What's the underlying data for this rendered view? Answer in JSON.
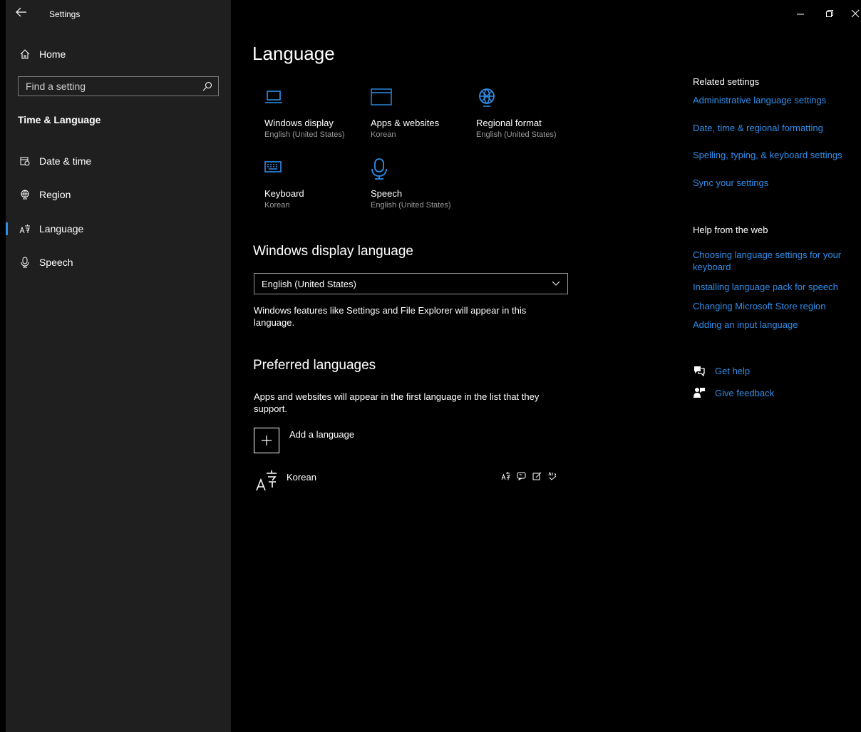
{
  "window": {
    "title": "Settings"
  },
  "sidebar": {
    "home_label": "Home",
    "search_placeholder": "Find a setting",
    "section_title": "Time & Language",
    "items": [
      {
        "label": "Date & time",
        "icon": "calendar-clock-icon"
      },
      {
        "label": "Region",
        "icon": "globe-icon"
      },
      {
        "label": "Language",
        "icon": "language-icon",
        "active": true
      },
      {
        "label": "Speech",
        "icon": "microphone-icon"
      }
    ]
  },
  "main": {
    "title": "Language",
    "tiles": [
      {
        "label": "Windows display",
        "sub": "English (United States)",
        "icon": "monitor-icon"
      },
      {
        "label": "Apps & websites",
        "sub": "Korean",
        "icon": "browser-window-icon"
      },
      {
        "label": "Regional format",
        "sub": "English (United States)",
        "icon": "globe-icon"
      },
      {
        "label": "Keyboard",
        "sub": "Korean",
        "icon": "keyboard-icon"
      },
      {
        "label": "Speech",
        "sub": "English (United States)",
        "icon": "microphone-icon"
      }
    ],
    "display_language": {
      "heading": "Windows display language",
      "selected": "English (United States)",
      "description": "Windows features like Settings and File Explorer will appear in this language."
    },
    "preferred": {
      "heading": "Preferred languages",
      "description": "Apps and websites will appear in the first language in the list that they support.",
      "add_label": "Add a language",
      "languages": [
        {
          "name": "Korean",
          "features": [
            "display-language-icon",
            "speech-icon",
            "handwriting-icon",
            "spell-check-icon"
          ]
        }
      ]
    }
  },
  "related": {
    "heading": "Related settings",
    "links": [
      "Administrative language settings",
      "Date, time & regional formatting",
      "Spelling, typing, & keyboard settings",
      "Sync your settings"
    ]
  },
  "help": {
    "heading": "Help from the web",
    "links": [
      "Choosing language settings for your keyboard",
      "Installing language pack for speech",
      "Changing Microsoft Store region",
      "Adding an input language"
    ],
    "get_help": "Get help",
    "give_feedback": "Give feedback"
  },
  "colors": {
    "accent": "#2f8ee8",
    "sidebar_bg": "#1f1f1f",
    "main_bg": "#000000"
  }
}
